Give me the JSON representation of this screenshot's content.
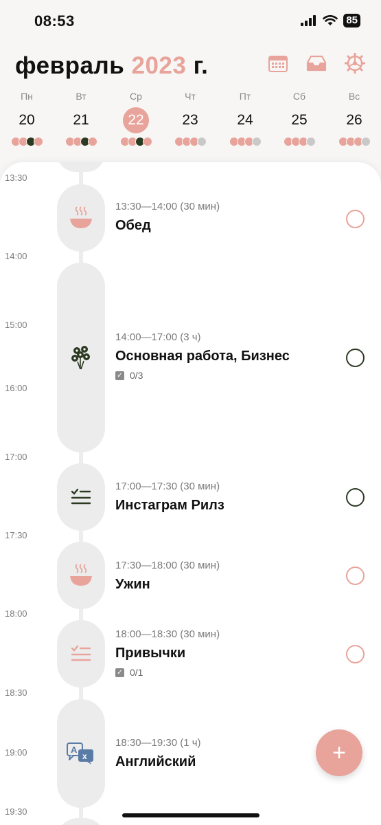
{
  "status": {
    "time": "08:53",
    "battery": "85"
  },
  "header": {
    "month": "февраль",
    "year": "2023",
    "suffix": "г."
  },
  "week": [
    {
      "name": "Пн",
      "num": "20",
      "selected": false
    },
    {
      "name": "Вт",
      "num": "21",
      "selected": false
    },
    {
      "name": "Ср",
      "num": "22",
      "selected": true
    },
    {
      "name": "Чт",
      "num": "23",
      "selected": false
    },
    {
      "name": "Пт",
      "num": "24",
      "selected": false
    },
    {
      "name": "Сб",
      "num": "25",
      "selected": false
    },
    {
      "name": "Вс",
      "num": "26",
      "selected": false
    }
  ],
  "timeline": {
    "hours": [
      "13:30",
      "14:00",
      "15:00",
      "16:00",
      "17:00",
      "17:30",
      "18:00",
      "18:30",
      "19:00",
      "19:30"
    ],
    "tasks": [
      {
        "time": "13:30—14:00 (30 мин)",
        "title": "Обед",
        "icon": "bowl-icon",
        "done_color": "pink"
      },
      {
        "time": "14:00—17:00 (3 ч)",
        "title": "Основная работа, Бизнес",
        "icon": "flowers-icon",
        "subtasks": "0/3",
        "done_color": "dark"
      },
      {
        "time": "17:00—17:30 (30 мин)",
        "title": "Инстаграм Рилз",
        "icon": "checklist-icon",
        "done_color": "dark"
      },
      {
        "time": "17:30—18:00 (30 мин)",
        "title": "Ужин",
        "icon": "bowl-icon",
        "done_color": "pink"
      },
      {
        "time": "18:00—18:30 (30 мин)",
        "title": "Привычки",
        "icon": "checklist-icon",
        "subtasks": "0/1",
        "done_color": "pink"
      },
      {
        "time": "18:30—19:30 (1 ч)",
        "title": "Английский",
        "icon": "translate-icon",
        "done_color": "blue"
      }
    ]
  },
  "fab": {
    "label": "+"
  },
  "colors": {
    "accent": "#e8a39a",
    "dark": "#2d3a22",
    "background": "#f7f6f5"
  }
}
